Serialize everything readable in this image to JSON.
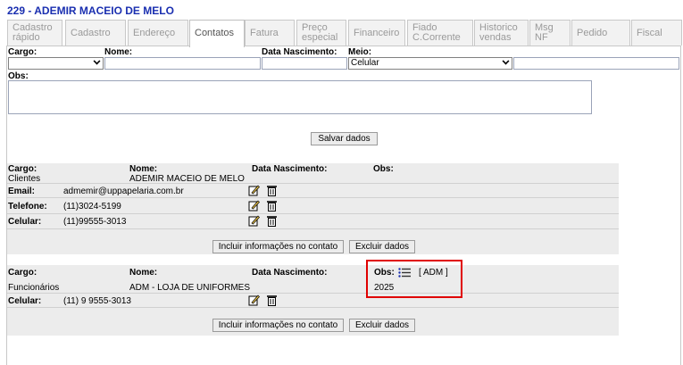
{
  "header": {
    "title": "229 - ADEMIR MACEIO DE MELO"
  },
  "tabs": [
    {
      "line1": "Cadastro",
      "line2": "rápido"
    },
    {
      "line1": "Cadastro",
      "line2": ""
    },
    {
      "line1": "Endereço",
      "line2": ""
    },
    {
      "line1": "Contatos",
      "line2": ""
    },
    {
      "line1": "Fatura",
      "line2": ""
    },
    {
      "line1": "Preço",
      "line2": "especial"
    },
    {
      "line1": "Financeiro",
      "line2": ""
    },
    {
      "line1": "Fiado",
      "line2": "C.Corrente"
    },
    {
      "line1": "Historico",
      "line2": "vendas"
    },
    {
      "line1": "Msg",
      "line2": "NF"
    },
    {
      "line1": "Pedido",
      "line2": ""
    },
    {
      "line1": "Fiscal",
      "line2": ""
    }
  ],
  "form": {
    "cargo_label": "Cargo:",
    "nome_label": "Nome:",
    "nascimento_label": "Data Nascimento:",
    "meio_label": "Meio:",
    "meio_value": "Celular",
    "obs_label": "Obs:",
    "save_button": "Salvar dados"
  },
  "contacts": [
    {
      "cargo_label": "Cargo:",
      "nome_label": "Nome:",
      "nascimento_label": "Data Nascimento:",
      "obs_label": "Obs:",
      "cargo": "Clientes",
      "nome": "ADEMIR MACEIO DE MELO",
      "rows": [
        {
          "label": "Email:",
          "value": "admemir@uppapelaria.com.br"
        },
        {
          "label": "Telefone:",
          "value": "(11)3024-5199"
        },
        {
          "label": "Celular:",
          "value": "(11)99555-3013"
        }
      ],
      "add_button": "Incluir informações no contato",
      "delete_button": "Excluir dados"
    },
    {
      "cargo_label": "Cargo:",
      "nome_label": "Nome:",
      "nascimento_label": "Data Nascimento:",
      "obs_label": "Obs:",
      "obs_tag": "[ ADM ]",
      "obs_value": "2025",
      "cargo": "Funcionários",
      "nome": "ADM - LOJA DE UNIFORMES",
      "rows": [
        {
          "label": "Celular:",
          "value": "(11) 9 9555-3013"
        }
      ],
      "add_button": "Incluir informações no contato",
      "delete_button": "Excluir dados"
    }
  ]
}
